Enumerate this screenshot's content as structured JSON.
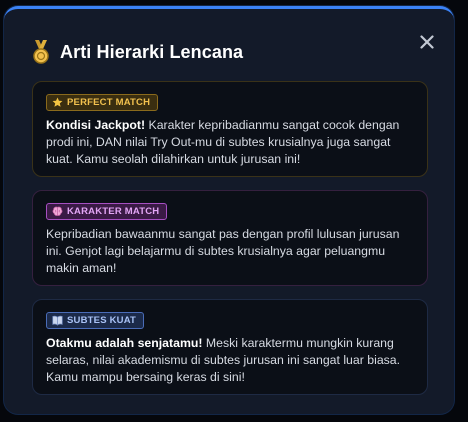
{
  "modal": {
    "title": "Arti Hierarki Lencana",
    "title_icon": "medal-icon",
    "close_icon": "close-icon"
  },
  "cards": [
    {
      "badge_label": "PERFECT MATCH",
      "badge_icon": "star-icon",
      "badge_color": "#f2c14e",
      "lead": "Kondisi Jackpot!",
      "text": " Karakter kepribadianmu sangat cocok dengan prodi ini, DAN nilai Try Out-mu di subtes krusialnya juga sangat kuat. Kamu seolah dilahirkan untuk jurusan ini!"
    },
    {
      "badge_label": "KARAKTER MATCH",
      "badge_icon": "brain-icon",
      "badge_color": "#e3a6f5",
      "lead": "",
      "text": "Kepribadian bawaanmu sangat pas dengan profil lulusan jurusan ini. Genjot lagi belajarmu di subtes krusialnya agar peluangmu makin aman!"
    },
    {
      "badge_label": "SUBTES KUAT",
      "badge_icon": "book-icon",
      "badge_color": "#a9c2f5",
      "lead": "Otakmu adalah senjatamu!",
      "text": " Meski karaktermu mungkin kurang selaras, nilai akademismu di subtes jurusan ini sangat luar biasa. Kamu mampu bersaing keras di sini!"
    }
  ]
}
